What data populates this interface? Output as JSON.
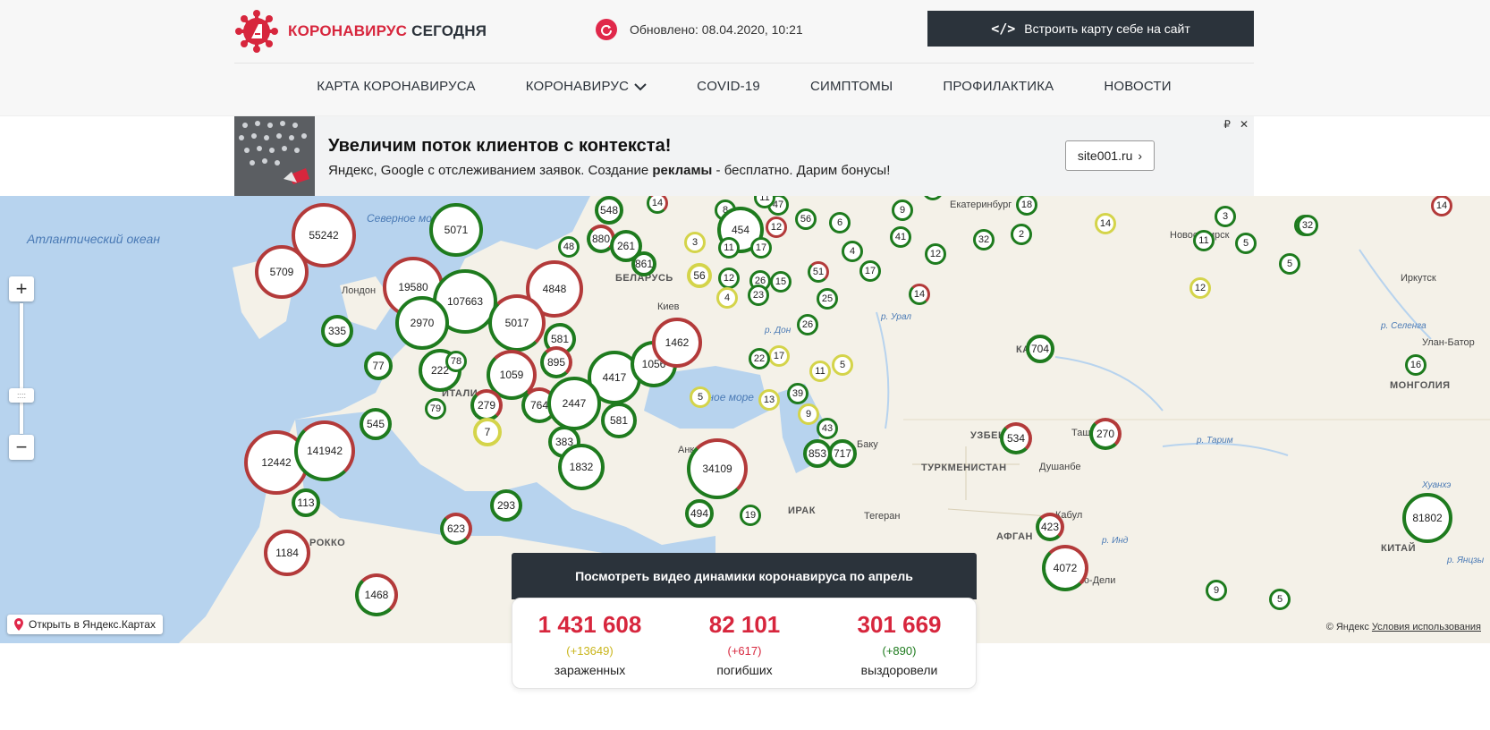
{
  "brand": {
    "name_red": "КОРОНАВИРУС",
    "name_dark": "СЕГОДНЯ",
    "accent": "#d7263d",
    "dark": "#2b333b"
  },
  "header": {
    "updated": "Обновлено: 08.04.2020, 10:21",
    "embed_label": "Встроить карту себе на сайт"
  },
  "nav": [
    "КАРТА КОРОНАВИРУСА",
    "КОРОНАВИРУС",
    "COVID-19",
    "СИМПТОМЫ",
    "ПРОФИЛАКТИКА",
    "НОВОСТИ"
  ],
  "ad": {
    "title": "Увеличим поток клиентов с контекста!",
    "text_pre": "Яндекс, Google с отслеживанием заявок. Создание ",
    "text_bold": "рекламы",
    "text_post": " - бесплатно. Дарим бонусы!",
    "button": "site001.ru",
    "ruble": "₽",
    "close": "✕"
  },
  "map": {
    "labels": {
      "ocean": "Атлантический океан",
      "north_sea": "Северное море",
      "black_sea": "Чёрное море",
      "london": "Лондон",
      "kiev": "Киев",
      "ankara": "Анкара",
      "tehran": "Тегеран",
      "baku": "Баку",
      "tashkent": "Ташкент",
      "dushanbe": "Душанбе",
      "kabul": "Кабул",
      "new_delhi": "Нью-Дели",
      "irkutsk": "Иркутск",
      "ulan_bator": "Улан-Батор",
      "ekaterinburg": "Екатеринбург",
      "belarus": "БЕЛАРУСЬ",
      "turkmenistan": "ТУРКМЕНИСТАН",
      "uzbek": "УЗБЕК",
      "mongolia": "МОНГОЛИЯ",
      "china": "КИТАЙ",
      "iraq": "ИРАК",
      "afghan": "АФГАН",
      "morocco": "РОККО",
      "italy": "ИТАЛИ",
      "kazakh": "КА      АН",
      "river_don": "р. Дон",
      "river_ural": "р. Урал",
      "river_tarim": "р. Тарим",
      "river_selenga": "р. Селенга",
      "river_ind": "р. Инд",
      "river_yanz": "р. Янцзы",
      "river_huanhe": "Хуанхэ",
      "novosibirsk": "Новосибирск"
    },
    "markers": [
      {
        "v": "5071",
        "c": "g"
      },
      {
        "v": "55242",
        "c": "r"
      },
      {
        "v": "5709",
        "c": "r"
      },
      {
        "v": "19580",
        "c": "r"
      },
      {
        "v": "107663",
        "c": "g"
      },
      {
        "v": "2970",
        "c": "g"
      },
      {
        "v": "4848",
        "c": "r"
      },
      {
        "v": "5017",
        "c": "m"
      },
      {
        "v": "581",
        "c": "g"
      },
      {
        "v": "335",
        "c": "g"
      },
      {
        "v": "77",
        "c": "g"
      },
      {
        "v": "222",
        "c": "g"
      },
      {
        "v": "78",
        "c": "g"
      },
      {
        "v": "1059",
        "c": "m"
      },
      {
        "v": "895",
        "c": "m"
      },
      {
        "v": "4417",
        "c": "g"
      },
      {
        "v": "1056",
        "c": "g"
      },
      {
        "v": "1462",
        "c": "r"
      },
      {
        "v": "764",
        "c": "m"
      },
      {
        "v": "2447",
        "c": "g"
      },
      {
        "v": "581",
        "c": "g"
      },
      {
        "v": "279",
        "c": "m"
      },
      {
        "v": "79",
        "c": "g"
      },
      {
        "v": "7",
        "c": "y"
      },
      {
        "v": "383",
        "c": "g"
      },
      {
        "v": "1832",
        "c": "g"
      },
      {
        "v": "545",
        "c": "g"
      },
      {
        "v": "12442",
        "c": "r"
      },
      {
        "v": "141942",
        "c": "m"
      },
      {
        "v": "113",
        "c": "g"
      },
      {
        "v": "293",
        "c": "g"
      },
      {
        "v": "623",
        "c": "m"
      },
      {
        "v": "1184",
        "c": "r"
      },
      {
        "v": "1468",
        "c": "m"
      },
      {
        "v": "34109",
        "c": "m"
      },
      {
        "v": "494",
        "c": "g"
      },
      {
        "v": "548",
        "c": "g"
      },
      {
        "v": "880",
        "c": "m"
      },
      {
        "v": "261",
        "c": "g"
      },
      {
        "v": "861",
        "c": "g"
      },
      {
        "v": "48",
        "c": "g"
      },
      {
        "v": "14",
        "c": "m"
      },
      {
        "v": "8",
        "c": "g"
      },
      {
        "v": "454",
        "c": "g"
      },
      {
        "v": "12",
        "c": "r"
      },
      {
        "v": "47",
        "c": "g"
      },
      {
        "v": "11",
        "c": "g"
      },
      {
        "v": "56",
        "c": "g"
      },
      {
        "v": "6",
        "c": "g"
      },
      {
        "v": "9",
        "c": "g"
      },
      {
        "v": "32",
        "c": "g"
      },
      {
        "v": "3",
        "c": "y"
      },
      {
        "v": "11",
        "c": "g"
      },
      {
        "v": "17",
        "c": "g"
      },
      {
        "v": "56",
        "c": "y"
      },
      {
        "v": "12",
        "c": "g"
      },
      {
        "v": "26",
        "c": "g"
      },
      {
        "v": "15",
        "c": "g"
      },
      {
        "v": "51",
        "c": "m"
      },
      {
        "v": "4",
        "c": "y"
      },
      {
        "v": "23",
        "c": "g"
      },
      {
        "v": "25",
        "c": "g"
      },
      {
        "v": "4",
        "c": "g"
      },
      {
        "v": "17",
        "c": "g"
      },
      {
        "v": "41",
        "c": "g"
      },
      {
        "v": "26",
        "c": "g"
      },
      {
        "v": "17",
        "c": "y"
      },
      {
        "v": "22",
        "c": "g"
      },
      {
        "v": "11",
        "c": "y"
      },
      {
        "v": "5",
        "c": "y"
      },
      {
        "v": "5",
        "c": "y"
      },
      {
        "v": "13",
        "c": "y"
      },
      {
        "v": "39",
        "c": "g"
      },
      {
        "v": "9",
        "c": "y"
      },
      {
        "v": "43",
        "c": "g"
      },
      {
        "v": "853",
        "c": "g"
      },
      {
        "v": "717",
        "c": "g"
      },
      {
        "v": "19",
        "c": "g"
      },
      {
        "v": "14",
        "c": "m"
      },
      {
        "v": "12",
        "c": "g"
      },
      {
        "v": "18",
        "c": "g"
      },
      {
        "v": "32",
        "c": "g"
      },
      {
        "v": "2",
        "c": "g"
      },
      {
        "v": "14",
        "c": "y"
      },
      {
        "v": "3",
        "c": "g"
      },
      {
        "v": "11",
        "c": "g"
      },
      {
        "v": "5",
        "c": "g"
      },
      {
        "v": "32",
        "c": "g"
      },
      {
        "v": "5",
        "c": "g"
      },
      {
        "v": "12",
        "c": "y"
      },
      {
        "v": "14",
        "c": "r"
      },
      {
        "v": "704",
        "c": "g"
      },
      {
        "v": "16",
        "c": "g"
      },
      {
        "v": "534",
        "c": "m"
      },
      {
        "v": "270",
        "c": "m"
      },
      {
        "v": "423",
        "c": "m"
      },
      {
        "v": "4072",
        "c": "m"
      },
      {
        "v": "81802",
        "c": "g"
      },
      {
        "v": "9",
        "c": "g"
      },
      {
        "v": "5",
        "c": "g"
      },
      {
        "v": "32",
        "c": "g"
      }
    ],
    "open_yandex": "Открыть в Яндекс.Картах",
    "copyright": "© Яндекс",
    "terms": "Условия использования"
  },
  "stats": {
    "title": "Посмотреть видео динамики коронавируса по апрель",
    "infected": {
      "num": "1 431 608",
      "delta": "(+13649)",
      "cap": "зараженных"
    },
    "dead": {
      "num": "82 101",
      "delta": "(+617)",
      "cap": "погибших"
    },
    "recovered": {
      "num": "301 669",
      "delta": "(+890)",
      "cap": "выздоровели"
    }
  }
}
